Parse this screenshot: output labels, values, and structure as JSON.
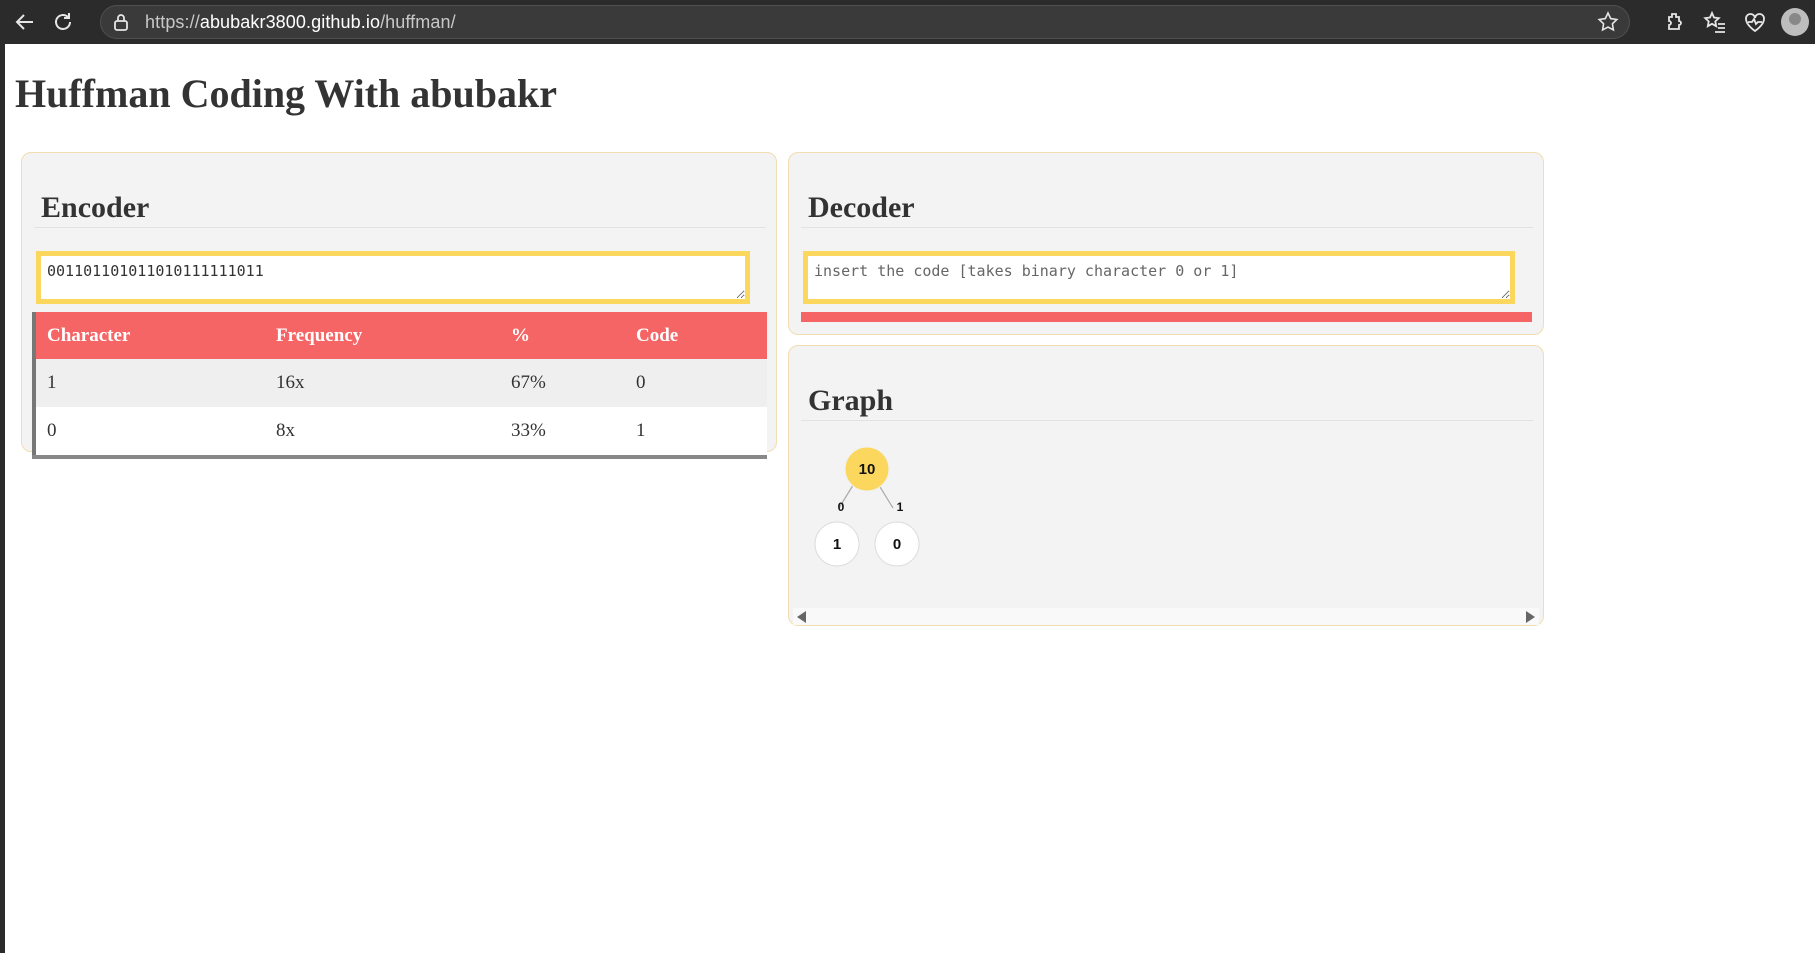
{
  "browser": {
    "url_prefix": "https://",
    "url_host": "abubakr3800.github.io",
    "url_path": "/huffman/",
    "icons": [
      "back-arrow-icon",
      "reload-icon",
      "lock-icon",
      "star-icon",
      "extensions-icon",
      "favorites-icon",
      "health-icon",
      "profile-avatar"
    ]
  },
  "page": {
    "title": "Huffman Coding With abubakr"
  },
  "encoder": {
    "heading": "Encoder",
    "input_value": "001101101011010111111011",
    "table": {
      "headers": [
        "Character",
        "Frequency",
        "%",
        "Code"
      ],
      "rows": [
        [
          "1",
          "16x",
          "67%",
          "0"
        ],
        [
          "0",
          "8x",
          "33%",
          "1"
        ]
      ]
    }
  },
  "decoder": {
    "heading": "Decoder",
    "placeholder": "insert the code [takes binary character 0 or 1]",
    "input_value": ""
  },
  "graph": {
    "heading": "Graph",
    "root": "10",
    "children": [
      {
        "edge": "0",
        "node": "1"
      },
      {
        "edge": "1",
        "node": "0"
      }
    ],
    "colors": {
      "root_fill": "#fbd85d",
      "leaf_fill": "#ffffff",
      "accent_red": "#f56565",
      "accent_yellow": "#fbd85d"
    }
  }
}
